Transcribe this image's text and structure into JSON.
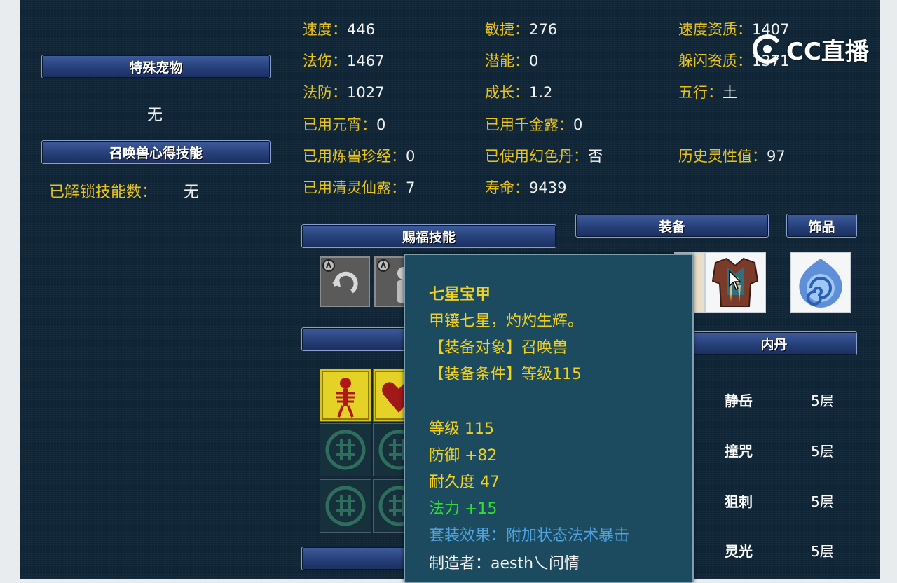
{
  "left": {
    "special_pet_title": "特殊宠物",
    "special_pet_value": "无",
    "summon_skill_title": "召唤兽心得技能",
    "unlocked_label": "已解锁技能数：",
    "unlocked_value": "无"
  },
  "stats": [
    {
      "label": "速度：",
      "value": "446"
    },
    {
      "label": "敏捷：",
      "value": "276"
    },
    {
      "label": "速度资质：",
      "value": "1407"
    },
    {
      "label": "法伤：",
      "value": "1467"
    },
    {
      "label": "潜能：",
      "value": "0"
    },
    {
      "label": "躲闪资质：",
      "value": "1371"
    },
    {
      "label": "法防：",
      "value": "1027"
    },
    {
      "label": "成长：",
      "value": "1.2"
    },
    {
      "label": "五行：",
      "value": "土"
    },
    {
      "label": "已用元宵：",
      "value": "0"
    },
    {
      "label": "已用千金露：",
      "value": "0"
    },
    {
      "label": "已用炼兽珍经：",
      "value": "0"
    },
    {
      "label": "已使用幻色丹：",
      "value": "否"
    },
    {
      "label": "历史灵性值：",
      "value": "97"
    },
    {
      "label": "已用清灵仙露：",
      "value": "7"
    },
    {
      "label": "寿命：",
      "value": "9439"
    }
  ],
  "sections": {
    "blessing_skills": "赐福技能",
    "equipment": "装备",
    "accessory": "饰品",
    "inner_dan": "内丹"
  },
  "inner_dans": [
    {
      "name": "静岳",
      "level": "5层"
    },
    {
      "name": "撞咒",
      "level": "5层"
    },
    {
      "name": "狙刺",
      "level": "5层"
    },
    {
      "name": "灵光",
      "level": "5层"
    }
  ],
  "tooltip": {
    "title": "七星宝甲",
    "desc": "甲镶七星，灼灼生辉。",
    "target": "【装备对象】召唤兽",
    "condition": "【装备条件】等级115",
    "level": "等级 115",
    "defense": "防御 +82",
    "durability": "耐久度 47",
    "magic": "法力 +15",
    "set_effect": "套装效果：附加状态法术暴击",
    "maker": "制造者：aesth乀问情"
  },
  "watermark": {
    "text": "CC直播"
  },
  "colors": {
    "panel": "#0f2535",
    "label": "#e8c21e",
    "value": "#f2f2f2",
    "tooltip_bg": "#1c4a5f",
    "green": "#33dd33",
    "blue": "#4fa3e0"
  },
  "icons": [
    "return-skill-icon",
    "figure-skill-icon",
    "chest-armor-icon",
    "swirl-orb-icon",
    "skeleton-icon",
    "heart-icon",
    "seal-empty-icon",
    "cursor-icon"
  ]
}
